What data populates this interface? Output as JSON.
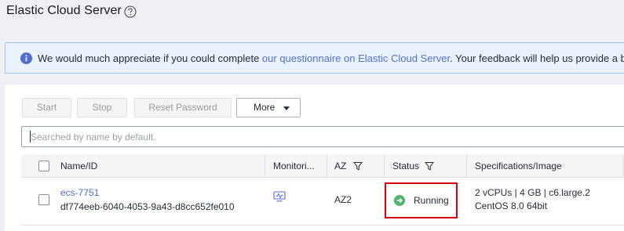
{
  "header": {
    "title": "Elastic Cloud Server",
    "help_icon": "question-circle-icon"
  },
  "banner": {
    "icon": "info-icon",
    "text_before": "We would much appreciate if you could complete ",
    "link_text": "our questionnaire on Elastic Cloud Server",
    "text_after": ". Your feedback will help us provide a better user e"
  },
  "toolbar": {
    "start_label": "Start",
    "stop_label": "Stop",
    "reset_password_label": "Reset Password",
    "more_label": "More"
  },
  "search": {
    "placeholder": "Searched by name by default."
  },
  "table": {
    "columns": [
      "Name/ID",
      "Monitori...",
      "AZ",
      "Status",
      "Specifications/Image"
    ],
    "rows": [
      {
        "name": "ecs-7751",
        "id": "df774eeb-6040-4053-9a43-d8cc652fe010",
        "monitoring_icon": "monitor-icon",
        "az": "AZ2",
        "status": "Running",
        "spec": "2 vCPUs | 4 GB | c6.large.2",
        "image": "CentOS 8.0 64bit"
      }
    ]
  },
  "colors": {
    "accent": "#526ecc",
    "running": "#50b371",
    "highlight": "#d9000d",
    "info": "#526ecc"
  }
}
